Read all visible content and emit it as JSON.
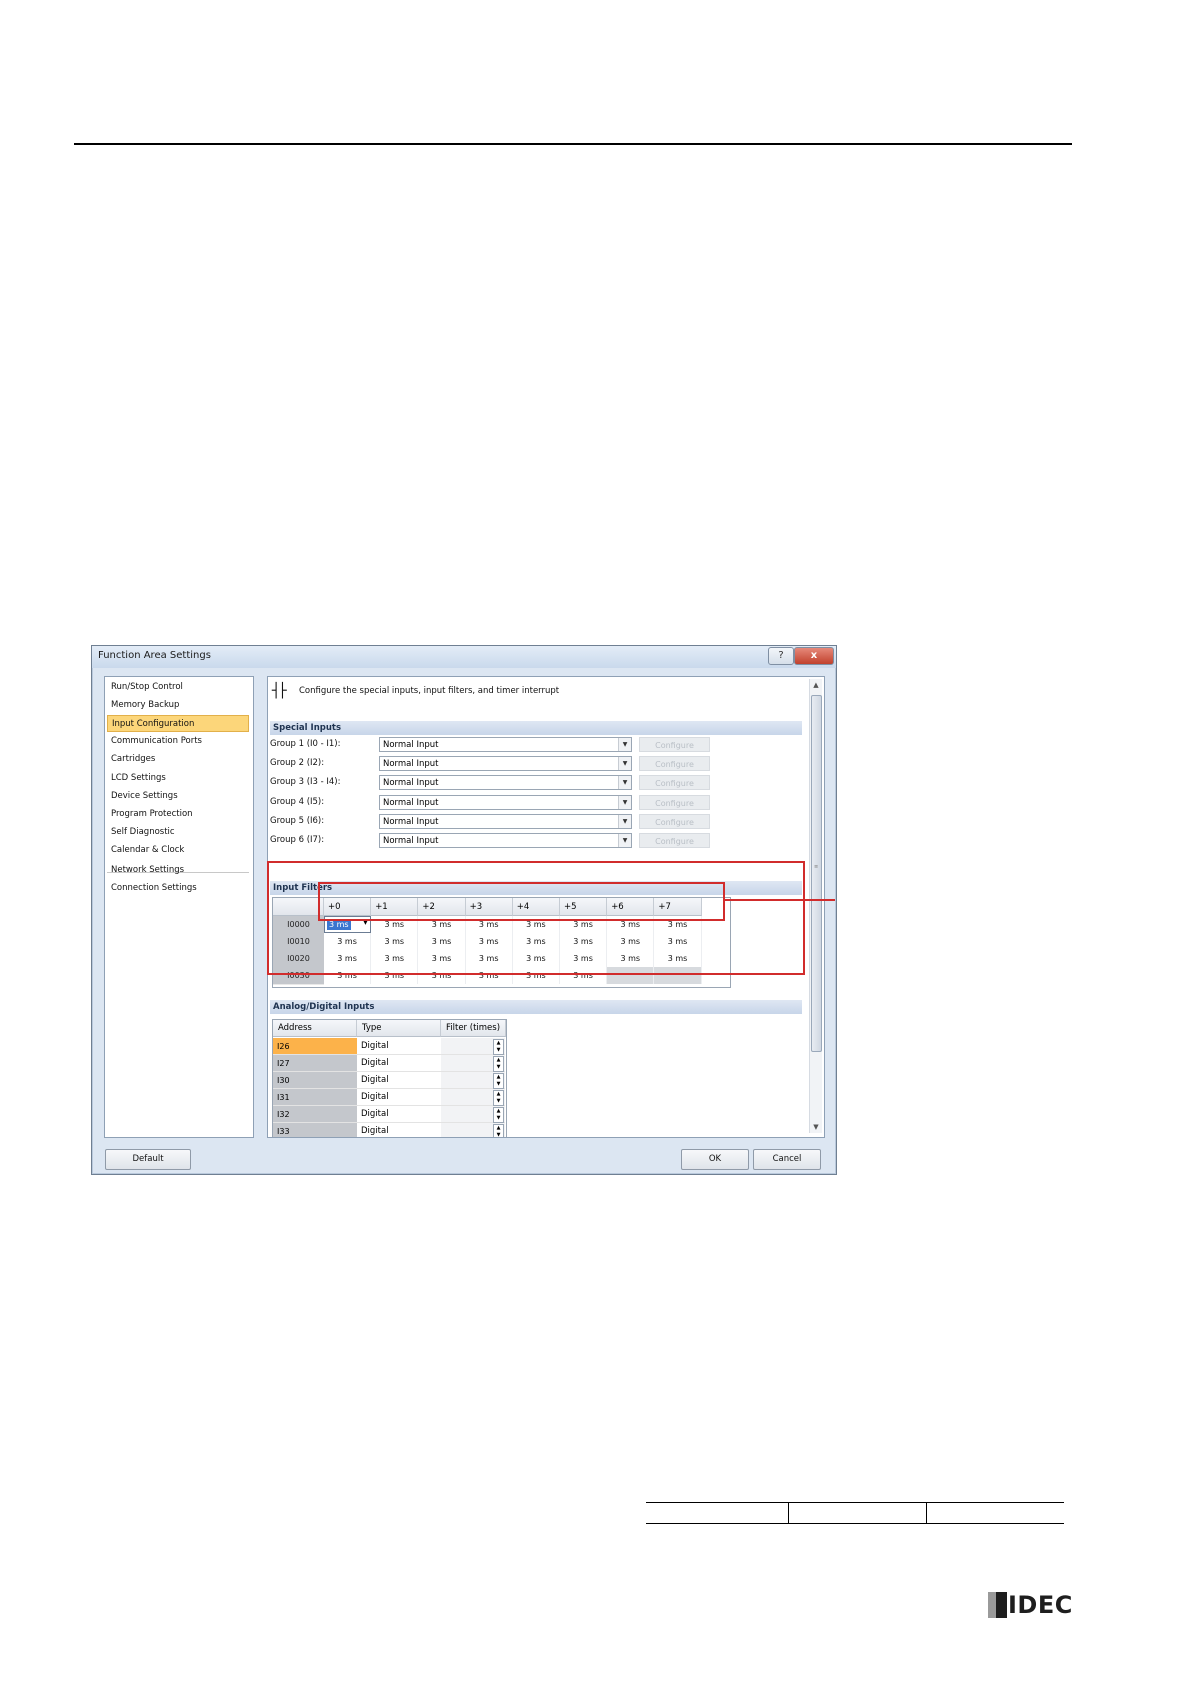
{
  "dialog": {
    "title": "Function Area Settings",
    "help_glyph": "?",
    "close_glyph": "x",
    "nav_items": [
      "Run/Stop Control",
      "Memory Backup",
      "Input Configuration",
      "Communication Ports",
      "Cartridges",
      "LCD Settings",
      "Device Settings",
      "Program Protection",
      "Self Diagnostic",
      "Calendar & Clock",
      "Network Settings",
      "Connection Settings"
    ],
    "selected_nav_index": 2,
    "header_text": "Configure the special inputs, input filters, and timer interrupt",
    "special_inputs": {
      "title": "Special Inputs",
      "configure_label": "Configure",
      "groups": [
        {
          "label": "Group 1 (I0 - I1):",
          "value": "Normal Input"
        },
        {
          "label": "Group 2 (I2):",
          "value": "Normal Input"
        },
        {
          "label": "Group 3 (I3 - I4):",
          "value": "Normal Input"
        },
        {
          "label": "Group 4 (I5):",
          "value": "Normal Input"
        },
        {
          "label": "Group 5 (I6):",
          "value": "Normal Input"
        },
        {
          "label": "Group 6 (I7):",
          "value": "Normal Input"
        }
      ]
    },
    "input_filters": {
      "title": "Input Filters",
      "columns": [
        "+0",
        "+1",
        "+2",
        "+3",
        "+4",
        "+5",
        "+6",
        "+7"
      ],
      "rows": [
        {
          "address": "I0000",
          "values": [
            "3 ms",
            "3 ms",
            "3 ms",
            "3 ms",
            "3 ms",
            "3 ms",
            "3 ms",
            "3 ms"
          ]
        },
        {
          "address": "I0010",
          "values": [
            "3 ms",
            "3 ms",
            "3 ms",
            "3 ms",
            "3 ms",
            "3 ms",
            "3 ms",
            "3 ms"
          ]
        },
        {
          "address": "I0020",
          "values": [
            "3 ms",
            "3 ms",
            "3 ms",
            "3 ms",
            "3 ms",
            "3 ms",
            "3 ms",
            "3 ms"
          ]
        },
        {
          "address": "I0030",
          "values": [
            "3 ms",
            "3 ms",
            "3 ms",
            "3 ms",
            "3 ms",
            "3 ms",
            "",
            ""
          ]
        }
      ]
    },
    "analog_digital_inputs": {
      "title": "Analog/Digital Inputs",
      "headers": [
        "Address",
        "Type",
        "Filter (times)"
      ],
      "rows": [
        {
          "address": "I26",
          "type": "Digital"
        },
        {
          "address": "I27",
          "type": "Digital"
        },
        {
          "address": "I30",
          "type": "Digital"
        },
        {
          "address": "I31",
          "type": "Digital"
        },
        {
          "address": "I32",
          "type": "Digital"
        },
        {
          "address": "I33",
          "type": "Digital"
        }
      ]
    },
    "buttons": {
      "default": "Default",
      "ok": "OK",
      "cancel": "Cancel"
    }
  },
  "logo": {
    "text": "IDEC"
  },
  "colors": {
    "highlight_red": "#d12c2c",
    "selection": "#fcd67a"
  }
}
